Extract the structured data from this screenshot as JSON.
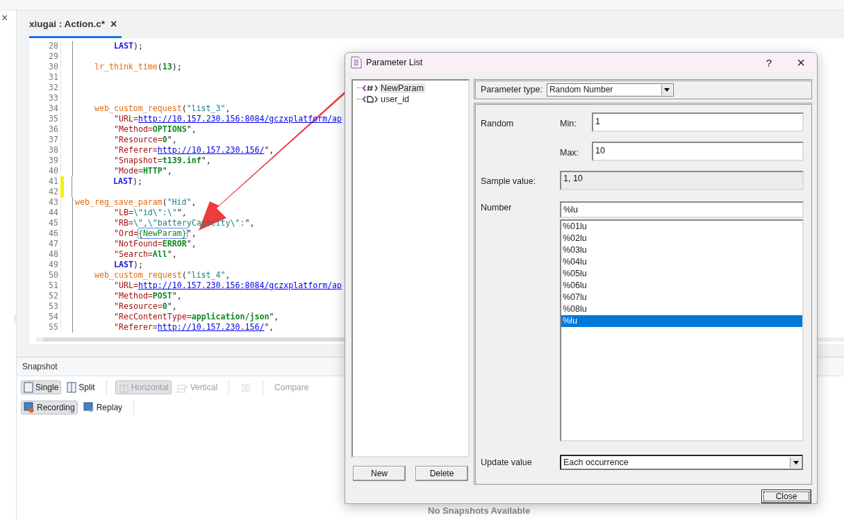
{
  "side_strip": {
    "close": "×"
  },
  "editor": {
    "tab": {
      "label": "xiugai : Action.c*",
      "close": "×",
      "selected": true
    },
    "lines": [
      {
        "number": "28",
        "modified": false,
        "kind": "two",
        "tokens": [
          {
            "kind": "kw",
            "text": "LAST"
          },
          {
            "kind": "p",
            "text": ");"
          }
        ]
      },
      {
        "number": "29",
        "modified": false
      },
      {
        "number": "30",
        "modified": false,
        "kind": "one",
        "tokens": [
          {
            "kind": "fn",
            "text": "lr_think_time"
          },
          {
            "kind": "p",
            "text": "("
          },
          {
            "kind": "val",
            "text": "13"
          },
          {
            "kind": "p",
            "text": ");"
          }
        ]
      },
      {
        "number": "31",
        "modified": false
      },
      {
        "number": "32",
        "modified": false
      },
      {
        "number": "33",
        "modified": false
      },
      {
        "number": "34",
        "modified": false,
        "kind": "one",
        "tokens": [
          {
            "kind": "fn",
            "text": "web_custom_request"
          },
          {
            "kind": "p",
            "text": "("
          },
          {
            "kind": "q",
            "text": "\"list_3\""
          },
          {
            "kind": "p",
            "text": ","
          }
        ]
      },
      {
        "number": "35",
        "modified": false,
        "kind": "two",
        "tokens": [
          {
            "kind": "key",
            "text": "\"URL="
          },
          {
            "kind": "url",
            "text": "http://10.157.230.156:8084/gczxplatform/ap"
          }
        ]
      },
      {
        "number": "36",
        "modified": false,
        "kind": "two",
        "tokens": [
          {
            "kind": "key",
            "text": "\"Method="
          },
          {
            "kind": "val",
            "text": "OPTIONS"
          },
          {
            "kind": "p",
            "text": "\","
          }
        ]
      },
      {
        "number": "37",
        "modified": false,
        "kind": "two",
        "tokens": [
          {
            "kind": "key",
            "text": "\"Resource="
          },
          {
            "kind": "val",
            "text": "0"
          },
          {
            "kind": "p",
            "text": "\","
          }
        ]
      },
      {
        "number": "38",
        "modified": false,
        "kind": "two",
        "tokens": [
          {
            "kind": "key",
            "text": "\"Referer="
          },
          {
            "kind": "url",
            "text": "http://10.157.230.156/"
          },
          {
            "kind": "p",
            "text": "\","
          }
        ]
      },
      {
        "number": "39",
        "modified": false,
        "kind": "two",
        "tokens": [
          {
            "kind": "key",
            "text": "\"Snapshot="
          },
          {
            "kind": "val",
            "text": "t139.inf"
          },
          {
            "kind": "p",
            "text": "\","
          }
        ]
      },
      {
        "number": "40",
        "modified": false,
        "kind": "two",
        "tokens": [
          {
            "kind": "key",
            "text": "\"Mode="
          },
          {
            "kind": "val",
            "text": "HTTP"
          },
          {
            "kind": "p",
            "text": "\","
          }
        ]
      },
      {
        "number": "41",
        "modified": true,
        "kind": "two",
        "tokens": [
          {
            "kind": "kw",
            "text": "LAST"
          },
          {
            "kind": "p",
            "text": ");"
          }
        ]
      },
      {
        "number": "42",
        "modified": true
      },
      {
        "number": "43",
        "modified": false,
        "kind": "none",
        "tokens": [
          {
            "kind": "fn",
            "text": "web_reg_save_param"
          },
          {
            "kind": "p",
            "text": "("
          },
          {
            "kind": "q",
            "text": "\"Hid\""
          },
          {
            "kind": "p",
            "text": ","
          }
        ]
      },
      {
        "number": "44",
        "modified": false,
        "kind": "two",
        "tokens": [
          {
            "kind": "key",
            "text": "\"LB="
          },
          {
            "kind": "q",
            "text": "\\\"id\\\":\\\""
          },
          {
            "kind": "p",
            "text": "\","
          }
        ]
      },
      {
        "number": "45",
        "modified": false,
        "kind": "two",
        "tokens": [
          {
            "kind": "key",
            "text": "\"RB="
          },
          {
            "kind": "q",
            "text": "\\\",\\\"batteryCapacity\\\":"
          },
          {
            "kind": "p",
            "text": "\","
          }
        ]
      },
      {
        "number": "46",
        "modified": false,
        "kind": "two",
        "tokens": [
          {
            "kind": "key",
            "text": "\"Ord="
          },
          {
            "kind": "param",
            "text": "{NewParam}"
          },
          {
            "kind": "p",
            "text": "\","
          }
        ]
      },
      {
        "number": "47",
        "modified": false,
        "kind": "two",
        "tokens": [
          {
            "kind": "key",
            "text": "\"NotFound="
          },
          {
            "kind": "val",
            "text": "ERROR"
          },
          {
            "kind": "p",
            "text": "\","
          }
        ]
      },
      {
        "number": "48",
        "modified": false,
        "kind": "two",
        "tokens": [
          {
            "kind": "key",
            "text": "\"Search="
          },
          {
            "kind": "val",
            "text": "All"
          },
          {
            "kind": "p",
            "text": "\","
          }
        ]
      },
      {
        "number": "49",
        "modified": false,
        "kind": "two",
        "tokens": [
          {
            "kind": "kw",
            "text": "LAST"
          },
          {
            "kind": "p",
            "text": ");"
          }
        ]
      },
      {
        "number": "50",
        "modified": false,
        "kind": "one",
        "tokens": [
          {
            "kind": "fn",
            "text": "web_custom_request"
          },
          {
            "kind": "p",
            "text": "("
          },
          {
            "kind": "q",
            "text": "\"list_4\""
          },
          {
            "kind": "p",
            "text": ","
          }
        ]
      },
      {
        "number": "51",
        "modified": false,
        "kind": "two",
        "tokens": [
          {
            "kind": "key",
            "text": "\"URL="
          },
          {
            "kind": "url",
            "text": "http://10.157.230.156:8084/gczxplatform/ap"
          }
        ]
      },
      {
        "number": "52",
        "modified": false,
        "kind": "two",
        "tokens": [
          {
            "kind": "key",
            "text": "\"Method="
          },
          {
            "kind": "val",
            "text": "POST"
          },
          {
            "kind": "p",
            "text": "\","
          }
        ]
      },
      {
        "number": "53",
        "modified": false,
        "kind": "two",
        "tokens": [
          {
            "kind": "key",
            "text": "\"Resource="
          },
          {
            "kind": "val",
            "text": "0"
          },
          {
            "kind": "p",
            "text": "\","
          }
        ]
      },
      {
        "number": "54",
        "modified": false,
        "kind": "two",
        "tokens": [
          {
            "kind": "key",
            "text": "\"RecContentType="
          },
          {
            "kind": "val",
            "text": "application/json"
          },
          {
            "kind": "p",
            "text": "\","
          }
        ]
      },
      {
        "number": "55",
        "modified": false,
        "kind": "two",
        "tokens": [
          {
            "kind": "key",
            "text": "\"Referer="
          },
          {
            "kind": "url",
            "text": "http://10.157.230.156/"
          },
          {
            "kind": "p",
            "text": "\","
          }
        ]
      }
    ]
  },
  "snapshot": {
    "title": "Snapshot",
    "toolbar_rows": [
      [
        {
          "kind": "single",
          "label": "Single",
          "pressed": true,
          "disabled": false
        },
        {
          "kind": "split",
          "label": "Split",
          "pressed": false,
          "disabled": false
        },
        {
          "kind": "sep"
        },
        {
          "kind": "horizontal",
          "label": "Horizontal",
          "pressed": true,
          "disabled": true
        },
        {
          "kind": "vertical",
          "label": "Vertical",
          "pressed": false,
          "disabled": true
        },
        {
          "kind": "sep"
        },
        {
          "kind": "swap",
          "pressed": false,
          "disabled": true
        },
        {
          "kind": "sep"
        },
        {
          "kind": "text",
          "label": "Compare",
          "pressed": false,
          "disabled": true
        }
      ],
      [
        {
          "kind": "recording",
          "label": "Recording",
          "pressed": true,
          "disabled": false
        },
        {
          "kind": "replay",
          "label": "Replay",
          "pressed": false,
          "disabled": false
        },
        {
          "kind": "sep"
        }
      ]
    ],
    "empty_message": "No Snapshots Available"
  },
  "dialog": {
    "title": "Parameter List",
    "help": "?",
    "close": "×",
    "parameters": [
      {
        "name": "NewParam",
        "kind": "number",
        "selected": true
      },
      {
        "name": "user_id",
        "kind": "file",
        "selected": false
      }
    ],
    "buttons": [
      "New",
      "Delete"
    ],
    "parameter_type": {
      "label": "Parameter type:",
      "value": "Random Number"
    },
    "random_label": "Random",
    "min": {
      "label": "Min:",
      "value": "1"
    },
    "max": {
      "label": "Max:",
      "value": "10"
    },
    "sample": {
      "label": "Sample value:",
      "value": "1, 10"
    },
    "number": {
      "label": "Number",
      "value": "%lu",
      "formats": [
        {
          "text": "%01lu",
          "selected": false
        },
        {
          "text": "%02lu",
          "selected": false
        },
        {
          "text": "%03lu",
          "selected": false
        },
        {
          "text": "%04lu",
          "selected": false
        },
        {
          "text": "%05lu",
          "selected": false
        },
        {
          "text": "%06lu",
          "selected": false
        },
        {
          "text": "%07lu",
          "selected": false
        },
        {
          "text": "%08lu",
          "selected": false
        },
        {
          "text": "%lu",
          "selected": true
        }
      ]
    },
    "update": {
      "label": "Update value",
      "value": "Each occurrence"
    },
    "close_button": "Close"
  }
}
